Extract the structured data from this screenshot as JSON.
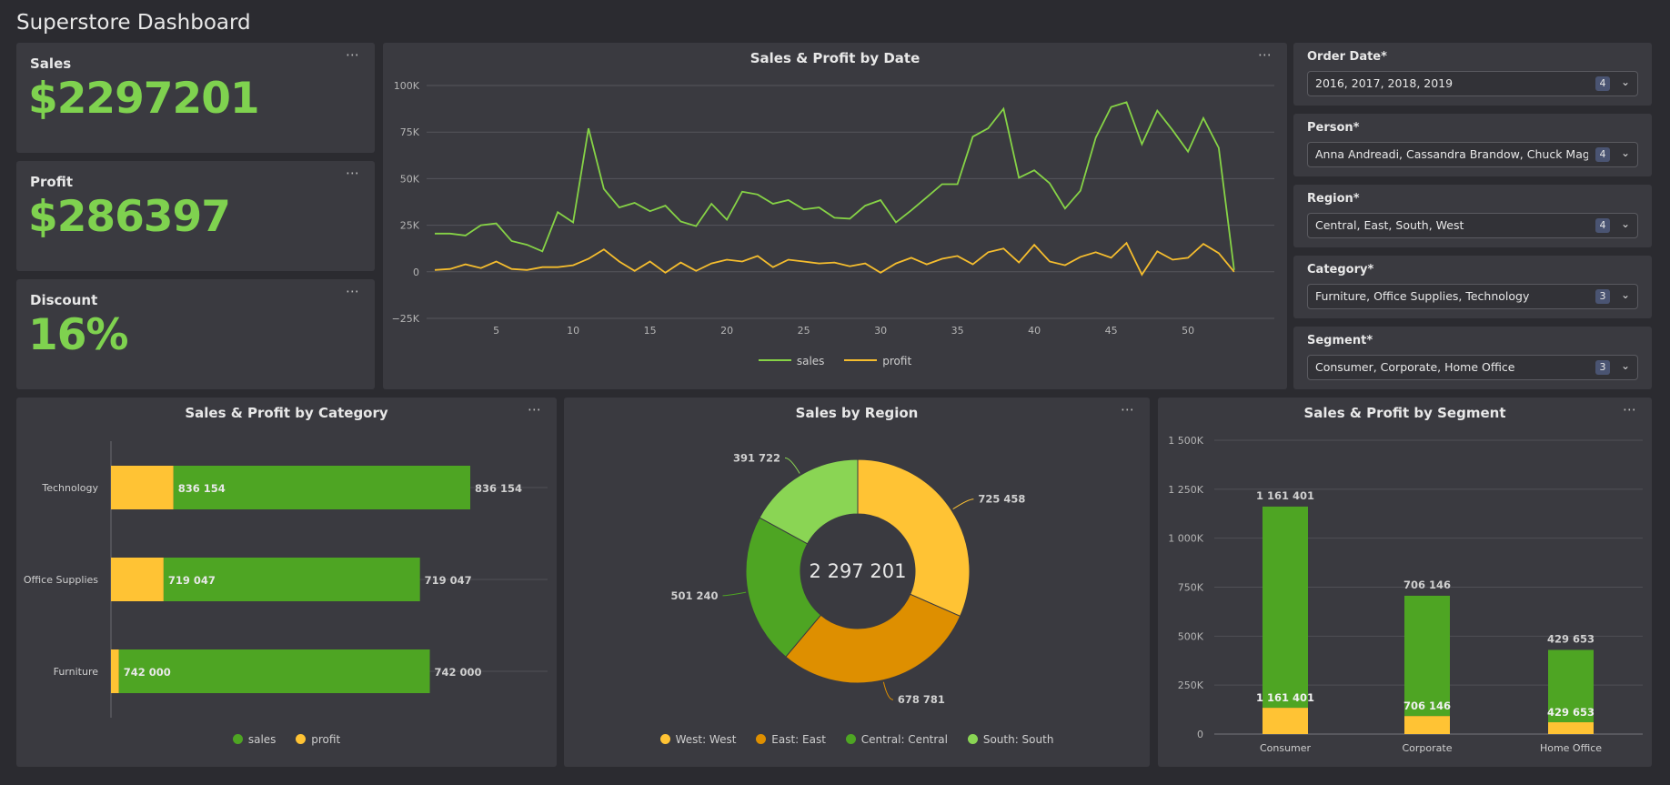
{
  "page": {
    "title": "Superstore Dashboard",
    "more_icon": "⋯"
  },
  "kpis": [
    {
      "label": "Sales",
      "value": "$2297201"
    },
    {
      "label": "Profit",
      "value": "$286397"
    },
    {
      "label": "Discount",
      "value": "16%"
    }
  ],
  "filters": [
    {
      "label": "Order Date*",
      "value": "2016, 2017, 2018, 2019",
      "count": "4"
    },
    {
      "label": "Person*",
      "value": "Anna Andreadi, Cassandra Brandow, Chuck Mage...",
      "count": "4"
    },
    {
      "label": "Region*",
      "value": "Central, East, South, West",
      "count": "4"
    },
    {
      "label": "Category*",
      "value": "Furniture, Office Supplies, Technology",
      "count": "3"
    },
    {
      "label": "Segment*",
      "value": "Consumer, Corporate, Home Office",
      "count": "3"
    }
  ],
  "colors": {
    "green": "#4ea523",
    "light_green": "#8ad554",
    "yellow": "#ffc334",
    "orange": "#de8f00",
    "line_green": "#86d346",
    "line_yellow": "#f5bd2e",
    "kpi": "#7fd24f"
  },
  "chart_data": [
    {
      "type": "line",
      "title": "Sales & Profit by Date",
      "x": [
        1,
        2,
        3,
        4,
        5,
        6,
        7,
        8,
        9,
        10,
        11,
        12,
        13,
        14,
        15,
        16,
        17,
        18,
        19,
        20,
        21,
        22,
        23,
        24,
        25,
        26,
        27,
        28,
        29,
        30,
        31,
        32,
        33,
        34,
        35,
        36,
        37,
        38,
        39,
        40,
        41,
        42,
        43,
        44,
        45,
        46,
        47,
        48,
        49,
        50,
        51,
        52,
        53
      ],
      "xticks": [
        5,
        10,
        15,
        20,
        25,
        30,
        35,
        40,
        45,
        50
      ],
      "yticks": [
        -25000,
        0,
        25000,
        50000,
        75000,
        100000
      ],
      "ytick_labels": [
        "−25K",
        "0",
        "25K",
        "50K",
        "75K",
        "100K"
      ],
      "ylim": [
        -25000,
        100000
      ],
      "series": [
        {
          "name": "sales",
          "values": [
            20500,
            20500,
            19500,
            25000,
            26000,
            16500,
            14500,
            11000,
            32000,
            26500,
            77000,
            44500,
            34500,
            37000,
            32500,
            35500,
            27000,
            24500,
            36500,
            28000,
            43000,
            41500,
            36500,
            38500,
            33500,
            34500,
            29000,
            28500,
            35500,
            38500,
            26500,
            33000,
            40000,
            47000,
            47000,
            72500,
            77000,
            87500,
            50500,
            54500,
            47500,
            34000,
            43500,
            72000,
            88500,
            91000,
            68500,
            86500,
            76000,
            64500,
            82500,
            66500,
            1000
          ]
        },
        {
          "name": "profit",
          "values": [
            1000,
            1500,
            4000,
            2000,
            5500,
            1500,
            1000,
            2500,
            2500,
            3500,
            7000,
            12000,
            5500,
            500,
            5500,
            -500,
            5000,
            500,
            4500,
            6500,
            5500,
            8500,
            2500,
            6500,
            5500,
            4500,
            5000,
            3000,
            4500,
            -500,
            4500,
            7500,
            4000,
            7000,
            8500,
            4000,
            10500,
            12500,
            5000,
            14500,
            5500,
            3500,
            8000,
            10500,
            7500,
            15500,
            -1500,
            11000,
            6500,
            7500,
            15000,
            10000,
            0
          ]
        }
      ],
      "legend": [
        "sales",
        "profit"
      ],
      "legend_position": "bottom"
    },
    {
      "type": "bar",
      "title": "Sales & Profit by Category",
      "orientation": "horizontal",
      "categories": [
        "Technology",
        "Office Supplies",
        "Furniture"
      ],
      "series": [
        {
          "name": "sales",
          "values": [
            836154,
            719047,
            742000
          ]
        },
        {
          "name": "profit",
          "values": [
            145455,
            122491,
            18451
          ]
        }
      ],
      "stacked": true,
      "data_labels": [
        "836 154",
        "719 047",
        "742 000"
      ],
      "legend": [
        "sales",
        "profit"
      ],
      "legend_position": "bottom"
    },
    {
      "type": "pie",
      "title": "Sales by Region",
      "donut": true,
      "center_label": "2 297 201",
      "slices": [
        {
          "name": "West: West",
          "value": 725458,
          "label": "725 458"
        },
        {
          "name": "East: East",
          "value": 678781,
          "label": "678 781"
        },
        {
          "name": "Central: Central",
          "value": 501240,
          "label": "501 240"
        },
        {
          "name": "South: South",
          "value": 391722,
          "label": "391 722"
        }
      ],
      "legend_position": "bottom"
    },
    {
      "type": "bar",
      "title": "Sales & Profit by Segment",
      "categories": [
        "Consumer",
        "Corporate",
        "Home Office"
      ],
      "series": [
        {
          "name": "sales",
          "values": [
            1161401,
            706146,
            429653
          ]
        },
        {
          "name": "profit",
          "values": [
            134119,
            91979,
            60299
          ]
        }
      ],
      "stacked": true,
      "data_labels": [
        "1 161 401",
        "706 146",
        "429 653"
      ],
      "yticks": [
        0,
        250000,
        500000,
        750000,
        1000000,
        1250000,
        1500000
      ],
      "ytick_labels": [
        "0",
        "250K",
        "500K",
        "750K",
        "1 000K",
        "1 250K",
        "1 500K"
      ],
      "ylim": [
        0,
        1500000
      ]
    }
  ]
}
